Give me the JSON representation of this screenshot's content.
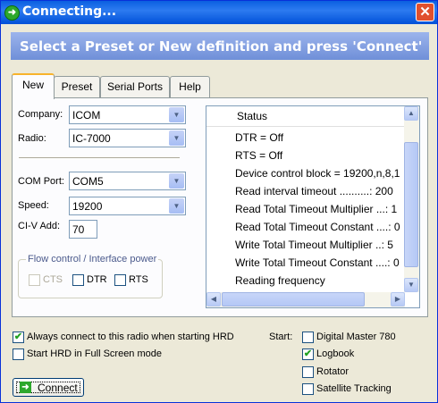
{
  "window": {
    "title": "Connecting...",
    "close_glyph": "✕",
    "title_icon": "connect-arrow-icon"
  },
  "banner": "Select a Preset or New definition and press 'Connect'",
  "tabs": [
    {
      "label": "New",
      "active": true
    },
    {
      "label": "Preset",
      "active": false
    },
    {
      "label": "Serial Ports",
      "active": false
    },
    {
      "label": "Help",
      "active": false
    }
  ],
  "form": {
    "company_label": "Company:",
    "company_value": "ICOM",
    "radio_label": "Radio:",
    "radio_value": "IC-7000",
    "com_port_label": "COM Port:",
    "com_port_value": "COM5",
    "speed_label": "Speed:",
    "speed_value": "19200",
    "civ_label": "CI-V Add:",
    "civ_value": "70"
  },
  "flow_control": {
    "title": "Flow control / Interface power",
    "cts": {
      "label": "CTS",
      "checked": false,
      "enabled": false
    },
    "dtr": {
      "label": "DTR",
      "checked": false,
      "enabled": true
    },
    "rts": {
      "label": "RTS",
      "checked": false,
      "enabled": true
    }
  },
  "status_list": {
    "header": "Status",
    "rows": [
      "DTR   = Off",
      "RTS   = Off",
      "Device control block = 19200,n,8,1",
      "Read interval timeout ..........: 200",
      "Read Total Timeout Multiplier ...: 1",
      "Read Total Timeout Constant ....: 0",
      "Write Total Timeout Multiplier ..: 5",
      "Write Total Timeout Constant ....: 0",
      "Reading frequency"
    ]
  },
  "options": {
    "always_connect": {
      "label": "Always connect to this radio when starting HRD",
      "checked": true
    },
    "full_screen": {
      "label": "Start HRD in Full Screen mode",
      "checked": false
    }
  },
  "start": {
    "label": "Start:",
    "items": [
      {
        "label": "Digital Master 780",
        "checked": false
      },
      {
        "label": "Logbook",
        "checked": true
      },
      {
        "label": "Rotator",
        "checked": false
      },
      {
        "label": "Satellite Tracking",
        "checked": false
      }
    ]
  },
  "connect_button": {
    "label": "Connect",
    "icon": "arrow-right-icon"
  },
  "check_glyph": "✔",
  "arrows": {
    "down": "▼",
    "up": "▲",
    "left": "◀",
    "right": "▶"
  }
}
